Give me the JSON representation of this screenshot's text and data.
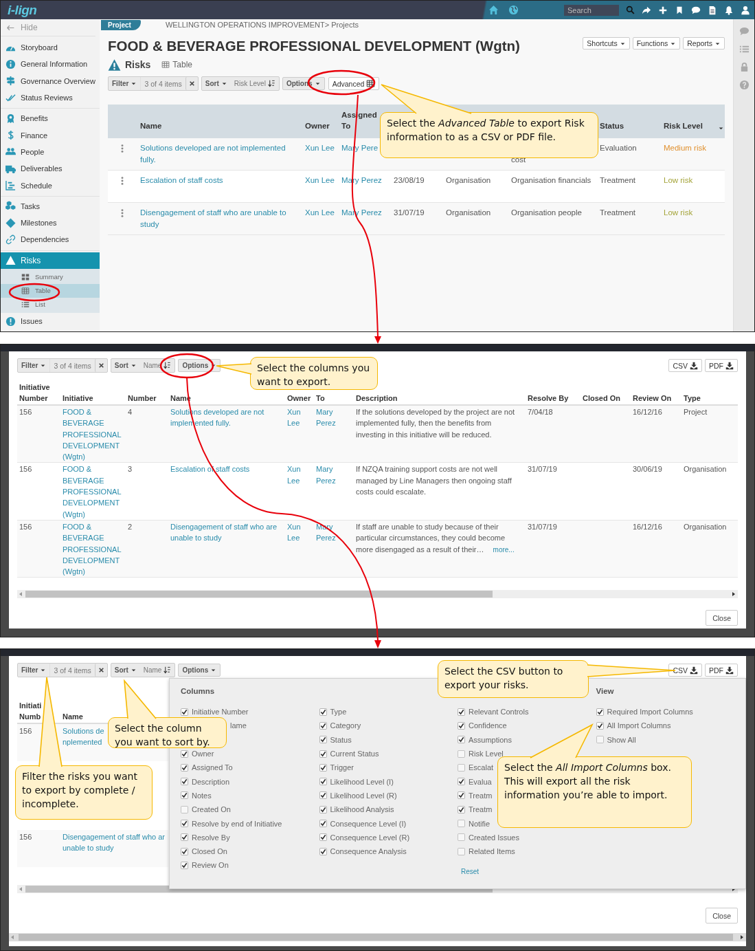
{
  "project_view": {
    "top_bar": {
      "logo": "i-lign",
      "search": {
        "placeholder": "Search"
      }
    },
    "sidebar": {
      "hide": "Hide",
      "groups": [
        {
          "items": [
            {
              "label": "Storyboard",
              "selected": false
            },
            {
              "label": "General Information",
              "selected": false
            },
            {
              "label": "Governance Overview",
              "selected": false
            },
            {
              "label": "Status Reviews",
              "selected": false
            }
          ]
        },
        {
          "items": [
            {
              "label": "Benefits",
              "selected": false
            },
            {
              "label": "Finance",
              "selected": false
            },
            {
              "label": "People",
              "selected": false
            },
            {
              "label": "Deliverables",
              "selected": false
            },
            {
              "label": "Schedule",
              "selected": false
            }
          ]
        },
        {
          "items": [
            {
              "label": "Tasks",
              "selected": false
            },
            {
              "label": "Milestones",
              "selected": false
            },
            {
              "label": "Dependencies",
              "selected": false
            }
          ]
        },
        {
          "items": [
            {
              "label": "Risks",
              "selected": true,
              "children": [
                {
                  "label": "Summary",
                  "selected": false
                },
                {
                  "label": "Table",
                  "selected": true
                },
                {
                  "label": "List",
                  "selected": false
                }
              ]
            },
            {
              "label": "Issues",
              "selected": false
            }
          ]
        }
      ]
    },
    "tab": "Project",
    "breadcrumb": "WELLINGTON OPERATIONS IMPROVEMENT> Projects",
    "title": "FOOD & BEVERAGE PROFESSIONAL DEVELOPMENT (Wgtn)",
    "header_buttons": [
      "Shortcuts",
      "Functions",
      "Reports"
    ],
    "section": "Risks",
    "view": "Table",
    "toolbar": {
      "filter": "Filter",
      "filter_count": "3 of 4 items",
      "sort": "Sort",
      "sort_field": "Risk Level",
      "options": "Options",
      "advanced": "Advanced"
    },
    "table": {
      "columns": [
        "Name",
        "Owner",
        "Assigned To",
        null,
        null,
        null,
        "Status",
        "Risk Level"
      ],
      "rows": [
        {
          "name": "Solutions developed are not implemented fully.",
          "owner": "Xun Lee",
          "assigned_to": "Mary Pere",
          "column_6": {
            "text": "cost",
            "first_line_hidden": true
          },
          "status": "Evaluation",
          "risk_level": "Medium risk",
          "color": "#e0902e"
        },
        {
          "name": "Escalation of staff costs",
          "owner": "Xun Lee",
          "assigned_to": "Mary Perez",
          "column_4": "23/08/19",
          "column_5": "Organisation",
          "column_6": "Organisation financials",
          "status": "Treatment",
          "risk_level": "Low risk",
          "color": "#a4a43a"
        },
        {
          "name": "Disengagement of staff who are unable to study",
          "owner": "Xun Lee",
          "assigned_to": "Mary Perez",
          "column_4": "31/07/19",
          "column_5": "Organisation",
          "column_6": "Organisation people",
          "status": "Treatment",
          "risk_level": "Low risk",
          "color": "#a4a43a"
        }
      ]
    }
  },
  "advanced_table_modal": {
    "toolbar": {
      "filter": "Filter",
      "filter_count": "3 of 4 items",
      "sort": "Sort",
      "sort_field": "Name",
      "options": "Options"
    },
    "export_buttons": [
      "CSV",
      "PDF"
    ],
    "table": {
      "columns": [
        "Initiative Number",
        "Initiative",
        "Number",
        "Name",
        "Owner",
        "To",
        "Description",
        "Resolve By",
        "Closed On",
        "Review On",
        "Type"
      ],
      "rows": [
        {
          "initiative_number": "156",
          "initiative": "FOOD & BEVERAGE PROFESSIONAL DEVELOPMENT (Wgtn)",
          "number": "4",
          "name": "Solutions developed are not implemented fully.",
          "owner": "Xun Lee",
          "assigned_to": "Mary Perez",
          "description": "If the solutions developed by the project are not implemented fully, then the benefits from investing in this initiative will be reduced.",
          "resolve_by": "7/04/18",
          "review_on": "16/12/16",
          "type": "Project"
        },
        {
          "initiative_number": "156",
          "initiative": "FOOD & BEVERAGE PROFESSIONAL DEVELOPMENT (Wgtn)",
          "number": "3",
          "name": "Escalation of staff costs",
          "owner": "Xun Lee",
          "assigned_to": "Mary Perez",
          "description": "If NZQA training support costs are not well managed by Line Managers then ongoing staff costs could escalate.",
          "resolve_by": "31/07/19",
          "review_on": "30/06/19",
          "type": "Organisation"
        },
        {
          "initiative_number": "156",
          "initiative": "FOOD & BEVERAGE PROFESSIONAL DEVELOPMENT (Wgtn)",
          "number": "2",
          "name": "Disengagement of staff who are unable to study",
          "owner": "Xun Lee",
          "assigned_to": "Mary Perez",
          "description": "If staff are unable to study because of their particular circumstances, they could become more disengaged as a result of their…",
          "more_link": "more...",
          "resolve_by": "31/07/19",
          "review_on": "16/12/16",
          "type": "Organisation"
        }
      ]
    },
    "close": "Close"
  },
  "column_options_modal": {
    "toolbar": {
      "filter": "Filter",
      "filter_count": "3 of 4 items",
      "sort": "Sort",
      "sort_field": "Name",
      "options": "Options"
    },
    "export_buttons": [
      "CSV",
      "PDF"
    ],
    "table": {
      "columns": [
        [
          "Initiati",
          "Numb"
        ],
        [
          "Name"
        ]
      ],
      "rows": [
        {
          "initiative_number": "156",
          "name": [
            "Solutions de",
            "nplemented"
          ]
        },
        {
          "initiative_number": "156",
          "name": [
            "Disengagement of staff who ar",
            "unable to study"
          ]
        }
      ]
    },
    "options_panel": {
      "heading": "Columns",
      "columns": [
        [
          {
            "kind": "checkbox",
            "label": "Initiative Number",
            "checked": true
          },
          {
            "kind": "partial",
            "label": "lame"
          },
          {
            "kind": "checkbox",
            "label": "Owner",
            "checked": true
          },
          {
            "kind": "checkbox",
            "label": "Assigned To",
            "checked": true
          },
          {
            "kind": "checkbox",
            "label": "Description",
            "checked": true
          },
          {
            "kind": "checkbox",
            "label": "Notes",
            "checked": true
          },
          {
            "kind": "checkbox",
            "label": "Created On",
            "checked": false
          },
          {
            "kind": "checkbox",
            "label": "Resolve by end of Initiative",
            "checked": true
          },
          {
            "kind": "checkbox",
            "label": "Resolve By",
            "checked": true
          },
          {
            "kind": "checkbox",
            "label": "Closed On",
            "checked": true
          },
          {
            "kind": "checkbox",
            "label": "Review On",
            "checked": true
          }
        ],
        [
          {
            "kind": "checkbox",
            "label": "Type",
            "checked": true
          },
          {
            "kind": "checkbox",
            "label": "Category",
            "checked": true
          },
          {
            "kind": "checkbox",
            "label": "Status",
            "checked": true
          },
          {
            "kind": "checkbox",
            "label": "Current Status",
            "checked": true
          },
          {
            "kind": "checkbox",
            "label": "Trigger",
            "checked": true
          },
          {
            "kind": "checkbox",
            "label": "Likelihood Level (I)",
            "checked": true
          },
          {
            "kind": "checkbox",
            "label": "Likelihood Level (R)",
            "checked": true
          },
          {
            "kind": "checkbox",
            "label": "Likelihood Analysis",
            "checked": true
          },
          {
            "kind": "checkbox",
            "label": "Consequence Level (I)",
            "checked": true
          },
          {
            "kind": "checkbox",
            "label": "Consequence Level (R)",
            "checked": true
          },
          {
            "kind": "checkbox",
            "label": "Consequence Analysis",
            "checked": true
          }
        ],
        [
          {
            "kind": "checkbox",
            "label": "Relevant Controls",
            "checked": true
          },
          {
            "kind": "checkbox",
            "label": "Confidence",
            "checked": true
          },
          {
            "kind": "checkbox",
            "label": "Assumptions",
            "checked": true
          },
          {
            "kind": "checkbox",
            "label": "Risk Level",
            "checked": false
          },
          {
            "kind": "checkbox",
            "label": "Escalat",
            "checked": false
          },
          {
            "kind": "checkbox",
            "label": "Evalua",
            "checked": true
          },
          {
            "kind": "checkbox",
            "label": "Treatm",
            "checked": true
          },
          {
            "kind": "checkbox",
            "label": "Treatm",
            "checked": true
          },
          {
            "kind": "checkbox",
            "label": "Notifie",
            "checked": false
          },
          {
            "kind": "checkbox",
            "label": "Created Issues",
            "checked": false
          },
          {
            "kind": "checkbox",
            "label": "Related Items",
            "checked": false
          }
        ]
      ],
      "reset": "Reset",
      "view_heading": "View",
      "view": [
        {
          "kind": "checkbox",
          "label": "Required Import Columns",
          "checked": true
        },
        {
          "kind": "checkbox",
          "label": "All Import Columns",
          "checked": true
        },
        {
          "kind": "checkbox",
          "label": "Show All",
          "checked": false
        }
      ]
    },
    "close": "Close"
  },
  "callouts": [
    {
      "text": "Select the *Advanced Table* to export Risk information to as a CSV or PDF file."
    },
    {
      "text": "Select the columns you want to export."
    },
    {
      "text": "Select the CSV button to export your risks."
    },
    {
      "text": "Select the column you want to sort by."
    },
    {
      "text": "Filter the risks you want to export by complete / incomplete."
    },
    {
      "text": "Select the *All Import Columns* box. This will export all the risk information you’re able to import."
    }
  ]
}
